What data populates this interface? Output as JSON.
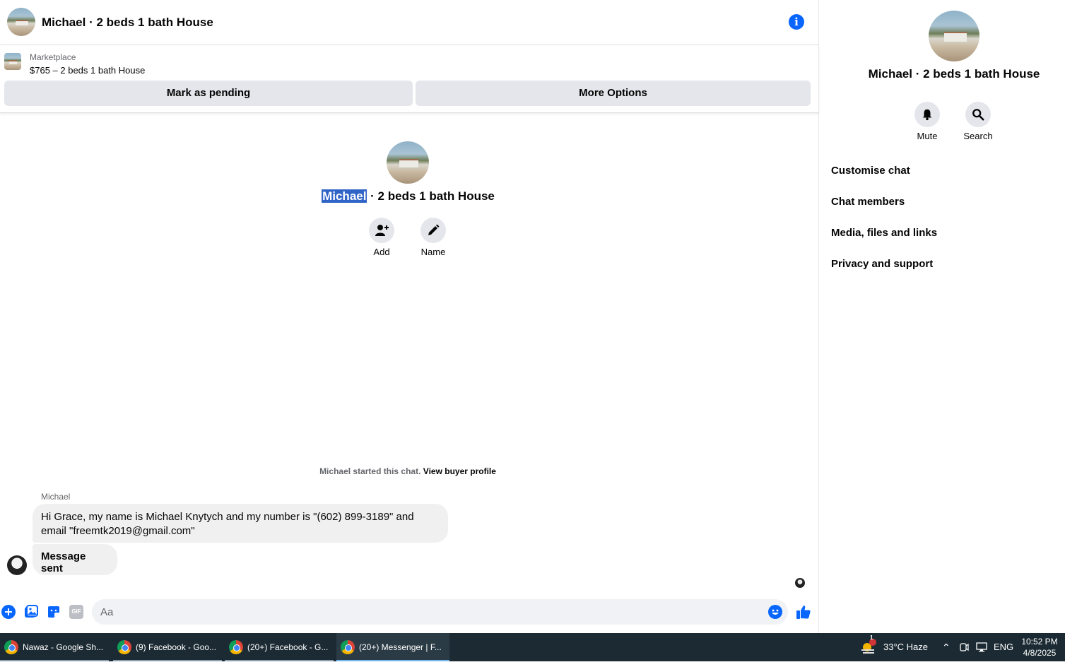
{
  "header": {
    "title": "Michael · 2 beds 1 bath House",
    "info_icon": "info-icon"
  },
  "listing": {
    "label": "Marketplace",
    "price_title": "$765 – 2 beds 1 bath House",
    "mark_pending": "Mark as pending",
    "more_options": "More Options"
  },
  "intro": {
    "name_highlight": "Michael",
    "title_rest": " · 2 beds 1 bath House",
    "add_label": "Add",
    "name_label": "Name"
  },
  "conversation": {
    "started_text": "Michael started this chat.",
    "view_profile": "View buyer profile",
    "sender": "Michael",
    "message_1": "Hi Grace, my name is Michael Knytych and my number is \"(602) 899-3189\" and email \"freemtk2019@gmail.com\"",
    "message_2": "Message sent"
  },
  "composer": {
    "placeholder": "Aa",
    "gif_label": "GIF"
  },
  "sidebar": {
    "title": "Michael · 2 beds 1 bath House",
    "mute_label": "Mute",
    "search_label": "Search",
    "menu": [
      "Customise chat",
      "Chat members",
      "Media, files and links",
      "Privacy and support"
    ]
  },
  "taskbar": {
    "tasks": [
      "Nawaz - Google Sh...",
      "(9) Facebook - Goo...",
      "(20+) Facebook - G...",
      "(20+) Messenger | F..."
    ],
    "weather": "33°C  Haze",
    "weather_badge": "1",
    "language": "ENG",
    "time": "10:52 PM",
    "date": "4/8/2025"
  },
  "colors": {
    "accent": "#0866ff",
    "button_bg": "#e4e6eb",
    "bubble_bg": "#f0f0f0",
    "selection": "#3064c7",
    "taskbar": "#1c2b33"
  }
}
